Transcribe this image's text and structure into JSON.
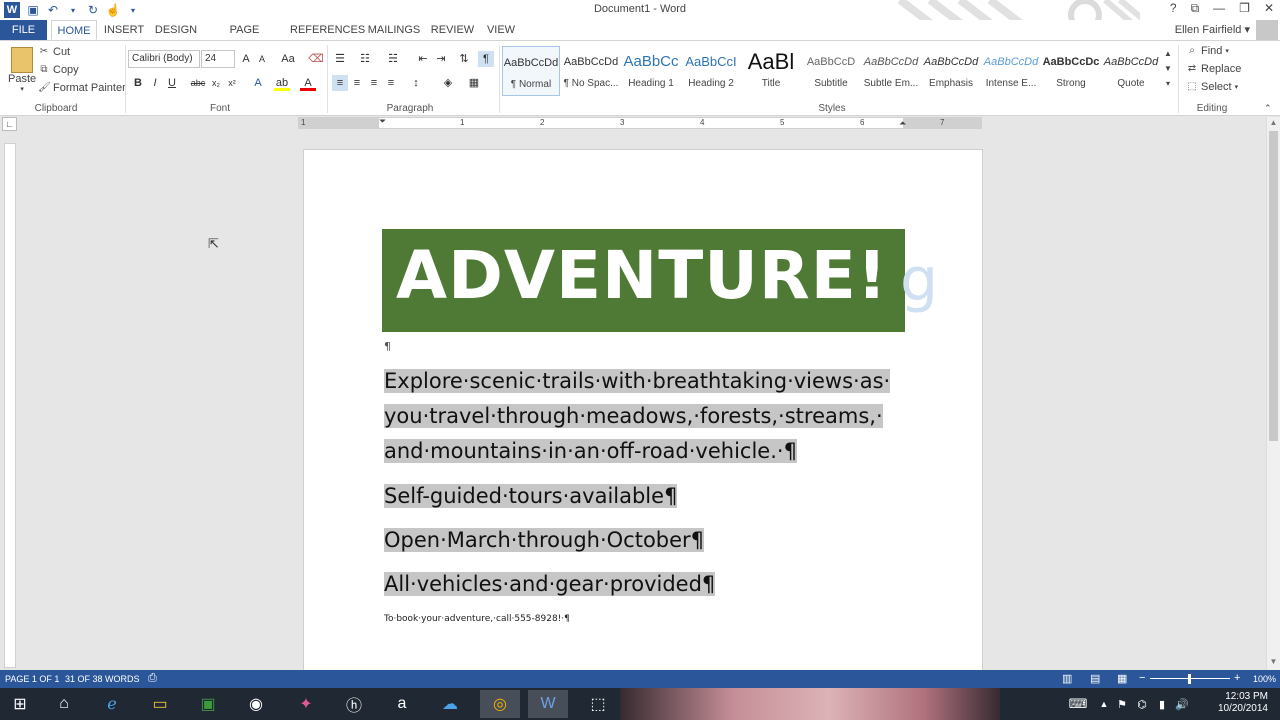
{
  "titlebar": {
    "title": "Document1 - Word",
    "help": "?",
    "user": "Ellen Fairfield"
  },
  "tabs": [
    "FILE",
    "HOME",
    "INSERT",
    "DESIGN",
    "PAGE LAYOUT",
    "REFERENCES",
    "MAILINGS",
    "REVIEW",
    "VIEW"
  ],
  "clipboard": {
    "paste": "Paste",
    "cut": "Cut",
    "copy": "Copy",
    "format_painter": "Format Painter",
    "label": "Clipboard"
  },
  "font": {
    "family": "Calibri (Body)",
    "size": "24",
    "label": "Font"
  },
  "paragraph": {
    "label": "Paragraph"
  },
  "styles": {
    "label": "Styles",
    "items": [
      {
        "preview": "AaBbCcDd",
        "name": "¶ Normal"
      },
      {
        "preview": "AaBbCcDd",
        "name": "¶ No Spac..."
      },
      {
        "preview": "AaBbCc",
        "name": "Heading 1"
      },
      {
        "preview": "AaBbCcI",
        "name": "Heading 2"
      },
      {
        "preview": "AaBl",
        "name": "Title"
      },
      {
        "preview": "AaBbCcD",
        "name": "Subtitle"
      },
      {
        "preview": "AaBbCcDd",
        "name": "Subtle Em..."
      },
      {
        "preview": "AaBbCcDd",
        "name": "Emphasis"
      },
      {
        "preview": "AaBbCcDd",
        "name": "Intense E..."
      },
      {
        "preview": "AaBbCcDc",
        "name": "Strong"
      },
      {
        "preview": "AaBbCcDd",
        "name": "Quote"
      }
    ]
  },
  "editing": {
    "find": "Find",
    "replace": "Replace",
    "select": "Select",
    "label": "Editing"
  },
  "ruler": {
    "numbers": [
      "1",
      "1",
      "2",
      "3",
      "4",
      "5",
      "6",
      "7"
    ]
  },
  "document": {
    "banner": "ADVENTURE!",
    "empty_para": "¶",
    "p1_lines": [
      "Explore·scenic·trails·with·breathtaking·views·as·",
      "you·travel·through·meadows,·forests,·streams,·",
      "and·mountains·in·an·off-road·vehicle.·¶"
    ],
    "p2": "Self-guided·tours·available¶",
    "p3": "Open·March·through·October¶",
    "p4": "All·vehicles·and·gear·provided¶",
    "p5": "To·book·your·adventure,·call·555-8928!·¶"
  },
  "status": {
    "page": "PAGE 1 OF 1",
    "words": "31 OF 38 WORDS",
    "zoom": "100%"
  },
  "taskbar": {
    "time": "12:03 PM",
    "date": "10/20/2014"
  },
  "colors": {
    "accent": "#2b579a",
    "banner": "#4f7a36",
    "highlight": "#c6c6c6"
  }
}
